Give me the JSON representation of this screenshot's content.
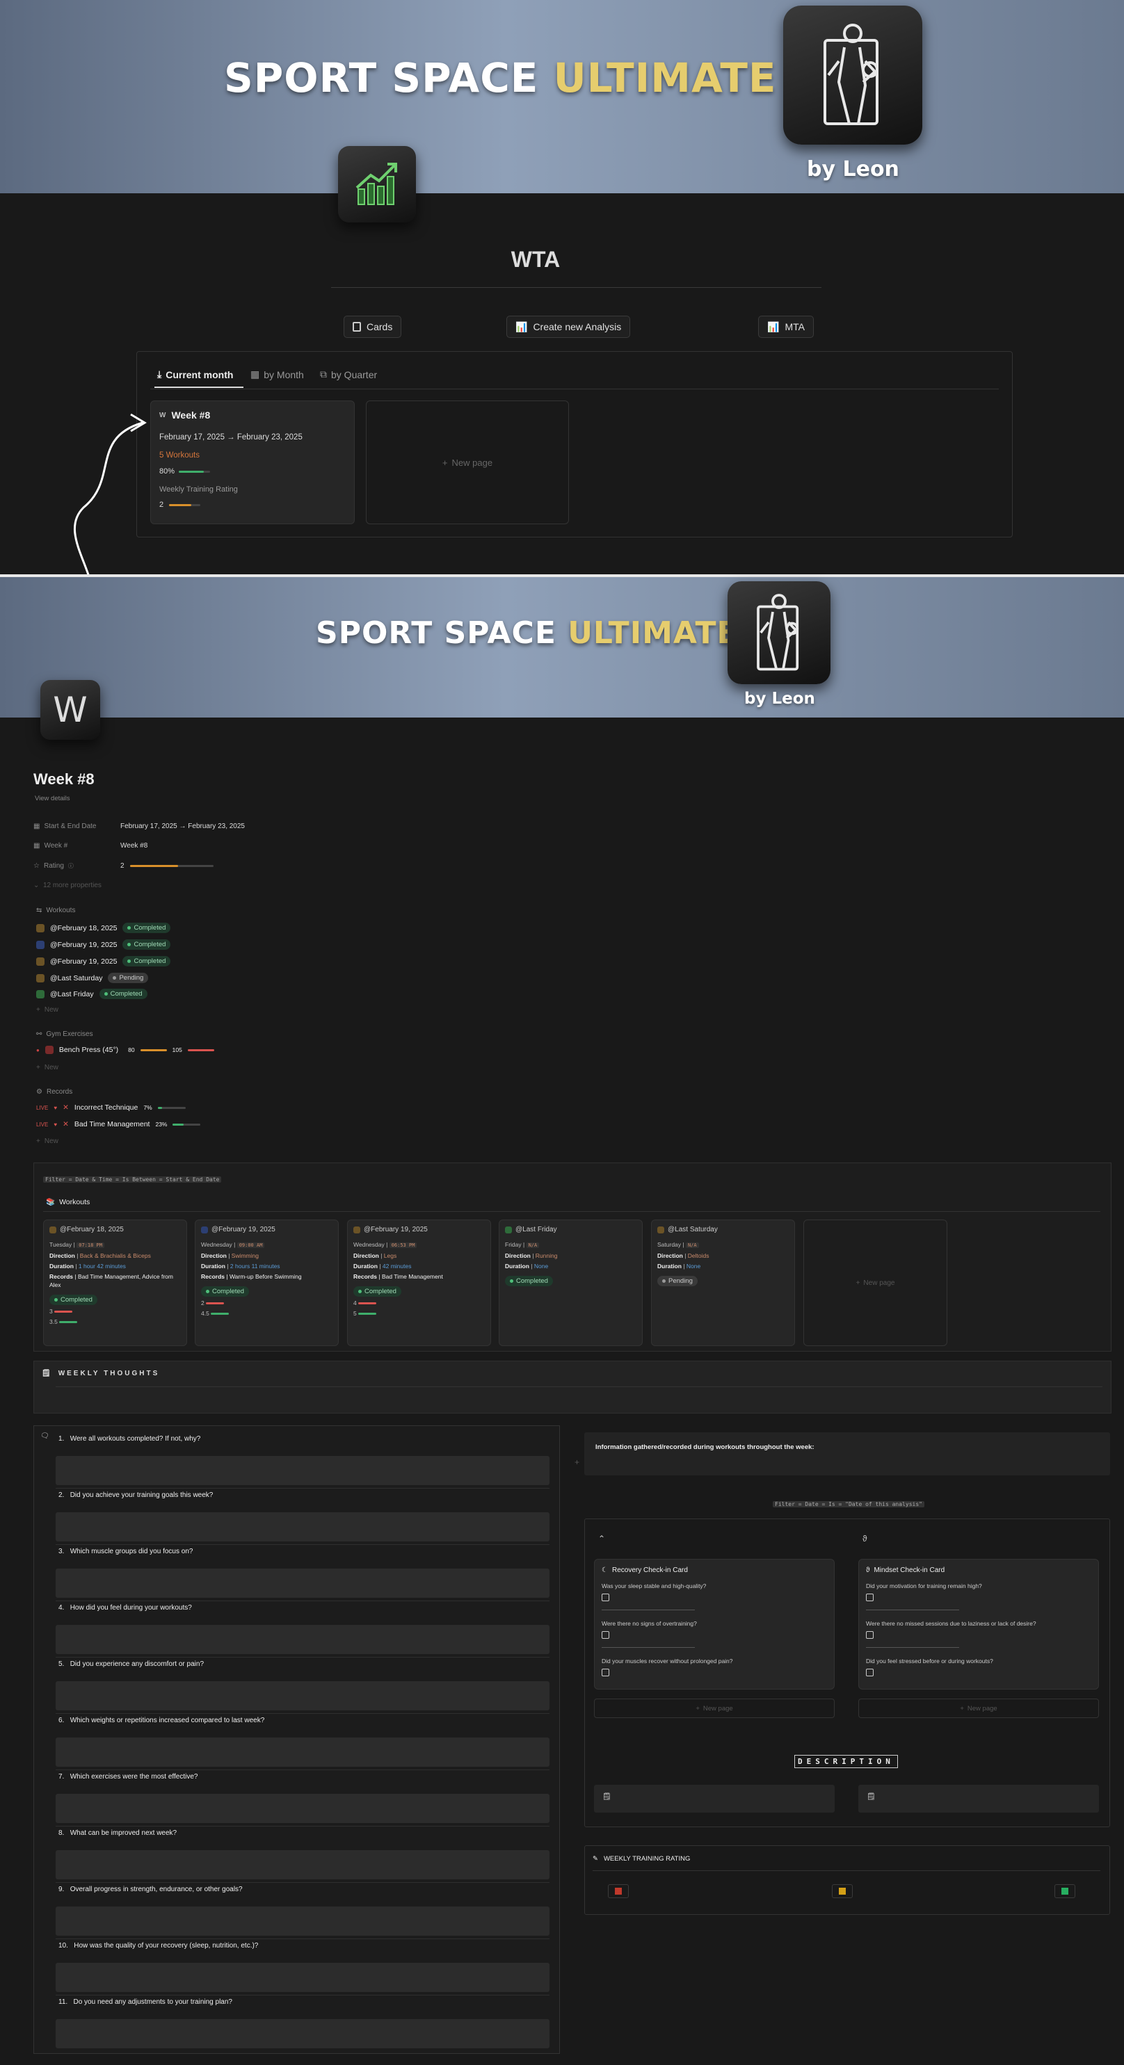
{
  "banner1": {
    "title_white": "SPORT SPACE ",
    "title_yellow": "ULTIMATE",
    "byline": "by Leon"
  },
  "banner2": {
    "title_white": "SPORT SPACE ",
    "title_yellow": "ULTIMATE",
    "byline": "by Leon"
  },
  "wta": {
    "title": "WTA",
    "buttons": {
      "cards": "Cards",
      "create": "Create new Analysis",
      "mta": "MTA"
    },
    "tabs": [
      "Current month",
      "by Month",
      "by Quarter"
    ],
    "card": {
      "title": "Week #8",
      "dates": "February 17, 2025 → February 23, 2025",
      "workouts": "5 Workouts",
      "percent": "80%",
      "percent_value": 0.8,
      "rating_label": "Weekly Training Rating",
      "rating": "2",
      "rating_value": 0.4
    },
    "new_page": "New page"
  },
  "page": {
    "title": "Week #8",
    "view_details": "View details",
    "props": {
      "date_label": "Start & End Date",
      "date_value": "February 17, 2025 → February 23, 2025",
      "week_label": "Week #",
      "week_value": "Week #8",
      "rating_label": "Rating",
      "rating_value": "2",
      "more": "12 more properties"
    },
    "workouts_header": "Workouts",
    "workouts": [
      {
        "name": "@February 18, 2025",
        "status": "Completed"
      },
      {
        "name": "@February 19, 2025",
        "status": "Completed"
      },
      {
        "name": "@February 19, 2025",
        "status": "Completed"
      },
      {
        "name": "@Last Saturday",
        "status": "Pending"
      },
      {
        "name": "@Last Friday",
        "status": "Completed"
      }
    ],
    "new": "New",
    "gym_header": "Gym Exercises",
    "gym": {
      "name": "Bench Press (45°)",
      "v1": "80",
      "v2": "105"
    },
    "records_header": "Records",
    "records": [
      {
        "live": "LIVE",
        "name": "Incorrect Technique",
        "pct": "7%",
        "pct_value": 0.07
      },
      {
        "live": "LIVE",
        "name": "Bad Time Management",
        "pct": "23%",
        "pct_value": 0.23
      }
    ]
  },
  "db": {
    "filter": "Filter = Date & Time = Is Between = Start & End Date",
    "title": "Workouts",
    "cards": [
      {
        "title": "@February 18, 2025",
        "day": "Tuesday |",
        "time": "07:18 PM",
        "direction": "Back & Brachialis & Biceps",
        "duration": "1 hour 42 minutes",
        "records": "Bad Time Management,  Advice from Alex",
        "status": "Completed",
        "v1": "3",
        "v2": "3.5"
      },
      {
        "title": "@February 19, 2025",
        "day": "Wednesday |",
        "time": "09:00 AM",
        "direction": "Swimming",
        "duration": "2 hours 11 minutes",
        "records": "Warm-up Before Swimming",
        "status": "Completed",
        "v1": "2",
        "v2": "4.5"
      },
      {
        "title": "@February 19, 2025",
        "day": "Wednesday |",
        "time": "06:53 PM",
        "direction": "Legs",
        "duration": "42 minutes",
        "records": "Bad Time Management",
        "status": "Completed",
        "v1": "4",
        "v2": "5"
      },
      {
        "title": "@Last Friday",
        "day": "Friday |",
        "time": "N/A",
        "direction": "Running",
        "duration": "None",
        "status": "Completed"
      },
      {
        "title": "@Last Saturday",
        "day": "Saturday |",
        "time": "N/A",
        "direction": "Deltoids",
        "duration": "None",
        "status": "Pending"
      }
    ],
    "labels": {
      "direction": "Direction",
      "duration": "Duration",
      "records": "Records"
    },
    "new_page": "New page"
  },
  "thoughts": {
    "title": "WEEKLY THOUGHTS"
  },
  "questions": [
    "Were all workouts completed? If not, why?",
    "Did you achieve your training goals this week?",
    "Which muscle groups did you focus on?",
    "How did you feel during your workouts?",
    "Did you experience any discomfort or pain?",
    "Which weights or repetitions increased compared to last week?",
    "Which exercises were the most effective?",
    "What can be improved next week?",
    "Overall progress in strength, endurance, or other goals?",
    "How was the quality of your recovery (sleep, nutrition, etc.)?",
    "Do you need any adjustments to your training plan?"
  ],
  "right": {
    "info": "Information gathered/recorded during workouts throughout the week:",
    "filter": "Filter = Date = Is = \"Date of this analysis\"",
    "recovery": {
      "title": "Recovery Check-in Card",
      "q": [
        "Was your sleep stable and high-quality?",
        "Were there no signs of overtraining?",
        "Did your muscles recover without prolonged pain?"
      ]
    },
    "mindset": {
      "title": "Mindset Check-in Card",
      "q": [
        "Did your motivation for training remain high?",
        "Were there no missed sessions due to laziness or lack of desire?",
        "Did you feel stressed before or during workouts?"
      ]
    },
    "new_page": "New page",
    "description": "DESCRIPTION",
    "rating_title": "WEEKLY TRAINING RATING"
  }
}
